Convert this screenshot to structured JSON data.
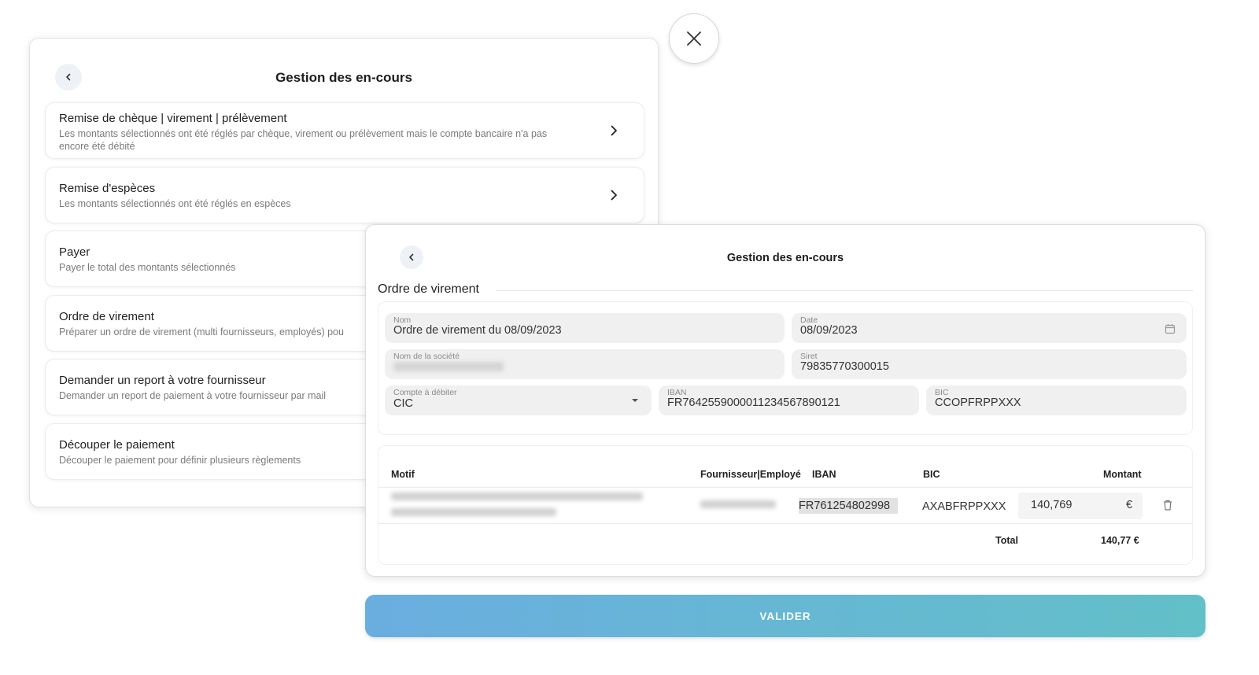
{
  "panel1": {
    "title": "Gestion des en-cours",
    "items": [
      {
        "title": "Remise de chèque | virement | prélèvement",
        "desc": "Les montants sélectionnés ont été réglés par chèque, virement ou prélèvement mais le compte bancaire n'a pas encore été débité"
      },
      {
        "title": "Remise d'espèces",
        "desc": "Les montants sélectionnés ont été réglés en espèces"
      },
      {
        "title": "Payer",
        "desc": "Payer le total des montants sélectionnés"
      },
      {
        "title": "Ordre de virement",
        "desc": "Préparer un ordre de virement (multi fournisseurs, employés) pou"
      },
      {
        "title": "Demander un report à votre fournisseur",
        "desc": "Demander un report de paiement à votre fournisseur par mail"
      },
      {
        "title": "Découper le paiement",
        "desc": "Découper le paiement pour définir plusieurs règlements"
      }
    ]
  },
  "panel2": {
    "title": "Gestion des en-cours",
    "section_title": "Ordre de virement",
    "form": {
      "nom": {
        "label": "Nom",
        "value": "Ordre de virement du 08/09/2023"
      },
      "date": {
        "label": "Date",
        "value": "08/09/2023"
      },
      "societe": {
        "label": "Nom de la société"
      },
      "siret": {
        "label": "Siret",
        "value": "79835770300015"
      },
      "compte": {
        "label": "Compte à débiter",
        "value": "CIC"
      },
      "iban": {
        "label": "IBAN",
        "value": "FR7642559000011234567890121"
      },
      "bic": {
        "label": "BIC",
        "value": "CCOPFRPPXXX"
      }
    },
    "table": {
      "headers": {
        "motif": "Motif",
        "fournisseur": "Fournisseur|Employé",
        "iban": "IBAN",
        "bic": "BIC",
        "montant": "Montant"
      },
      "row": {
        "iban": "FR761254802998",
        "bic": "AXABFRPPXXX",
        "amount": "140,769",
        "currency": "€"
      },
      "total_label": "Total",
      "total_value": "140,77 €"
    }
  },
  "valider_label": "VALIDER",
  "colors": {
    "accent_start": "#6aaee0",
    "accent_end": "#62c0c8"
  },
  "icons": {
    "close": "close-icon",
    "back": "chevron-left-icon",
    "chevron": "chevron-right-icon",
    "calendar": "calendar-icon",
    "dropdown": "caret-down-icon",
    "delete": "trash-icon"
  }
}
